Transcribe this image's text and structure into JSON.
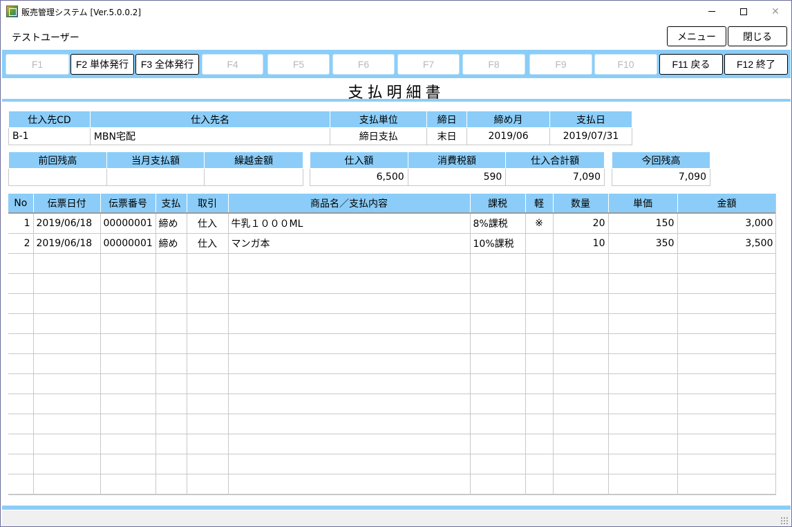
{
  "window": {
    "title": "販売管理システム [Ver.5.0.0.2]",
    "minimize": "minimize",
    "maximize": "maximize",
    "close": "✕"
  },
  "user": "テストユーザー",
  "top_buttons": {
    "menu": "メニュー",
    "close": "閉じる"
  },
  "fkeys": [
    {
      "label": "F1",
      "enabled": false
    },
    {
      "label": "F2 単体発行",
      "enabled": true
    },
    {
      "label": "F3 全体発行",
      "enabled": true
    },
    {
      "label": "F4",
      "enabled": false
    },
    {
      "label": "F5",
      "enabled": false
    },
    {
      "label": "F6",
      "enabled": false
    },
    {
      "label": "F7",
      "enabled": false
    },
    {
      "label": "F8",
      "enabled": false
    },
    {
      "label": "F9",
      "enabled": false
    },
    {
      "label": "F10",
      "enabled": false
    },
    {
      "label": "F11 戻る",
      "enabled": true
    },
    {
      "label": "F12 終了",
      "enabled": true
    }
  ],
  "heading": "支払明細書",
  "supplier": {
    "headers": [
      "仕入先CD",
      "仕入先名",
      "支払単位",
      "締日",
      "締め月",
      "支払日"
    ],
    "values": [
      "B-1",
      "MBN宅配",
      "締日支払",
      "末日",
      "2019/06",
      "2019/07/31"
    ]
  },
  "balance": {
    "headers": [
      "前回残高",
      "当月支払額",
      "繰越金額"
    ],
    "values": [
      "",
      "",
      ""
    ]
  },
  "purchase": {
    "headers": [
      "仕入額",
      "消費税額",
      "仕入合計額"
    ],
    "values": [
      "6,500",
      "590",
      "7,090"
    ]
  },
  "current_balance": {
    "header": "今回残高",
    "value": "7,090"
  },
  "detail": {
    "headers": [
      "No",
      "伝票日付",
      "伝票番号",
      "支払",
      "取引",
      "商品名／支払内容",
      "課税",
      "軽",
      "数量",
      "単価",
      "金額"
    ],
    "rows": [
      [
        "1",
        "2019/06/18",
        "00000001",
        "締め",
        "仕入",
        "牛乳１０００ML",
        "8%課税",
        "※",
        "20",
        "150",
        "3,000"
      ],
      [
        "2",
        "2019/06/18",
        "00000001",
        "締め",
        "仕入",
        "マンガ本",
        "10%課税",
        "",
        "10",
        "350",
        "3,500"
      ]
    ],
    "empty_rows": 12
  }
}
